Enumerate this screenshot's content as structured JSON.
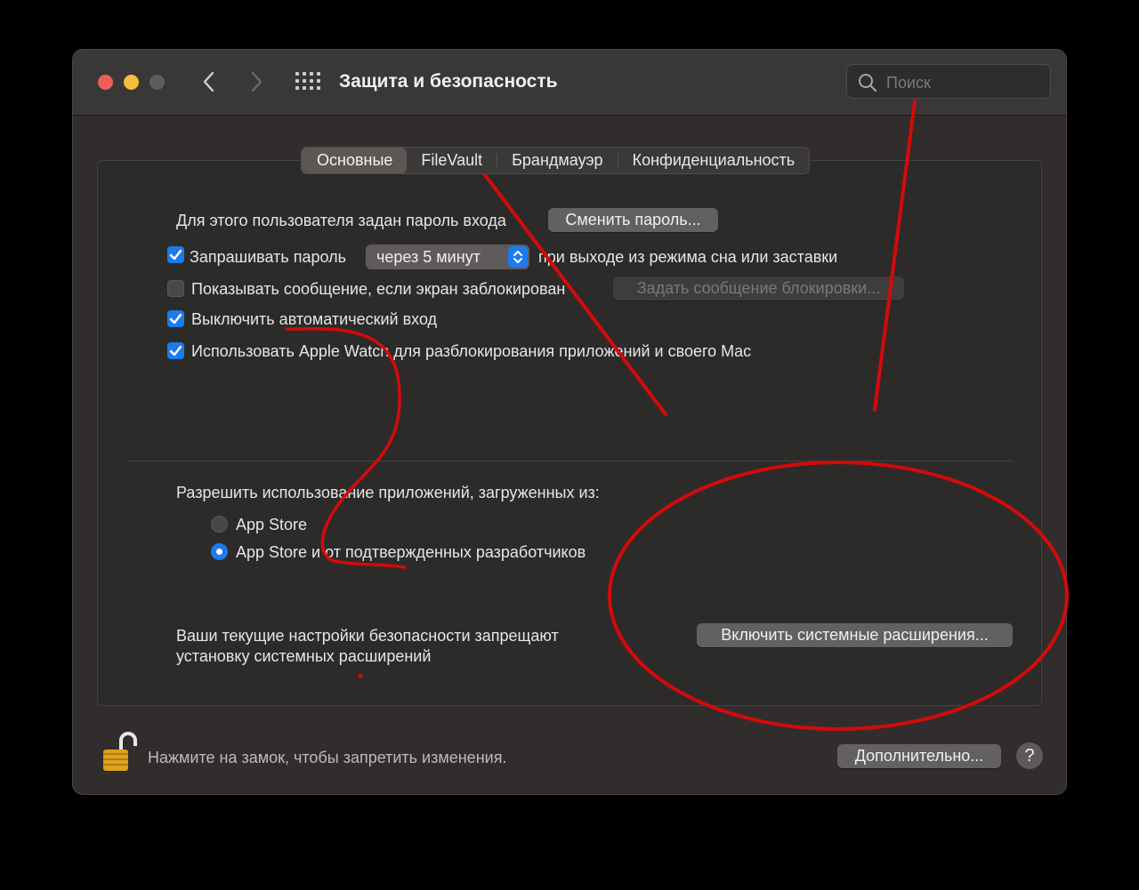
{
  "window": {
    "title": "Защита и безопасность",
    "search_placeholder": "Поиск"
  },
  "tabs": [
    {
      "label": "Основные",
      "selected": true
    },
    {
      "label": "FileVault",
      "selected": false
    },
    {
      "label": "Брандмауэр",
      "selected": false
    },
    {
      "label": "Конфиденциальность",
      "selected": false
    }
  ],
  "general": {
    "password_text": "Для этого пользователя задан пароль входа",
    "change_password_button": "Сменить пароль...",
    "require_password": {
      "checked": true,
      "label": "Запрашивать пароль",
      "select_value": "через 5 минут",
      "suffix": "при выходе из режима сна или заставки"
    },
    "show_message": {
      "checked": false,
      "label": "Показывать сообщение, если экран заблокирован",
      "button": "Задать сообщение блокировки..."
    },
    "disable_autologin": {
      "checked": true,
      "label": "Выключить автоматический вход"
    },
    "apple_watch": {
      "checked": true,
      "label": "Использовать Apple Watch для разблокирования приложений и своего Mac"
    }
  },
  "downloads": {
    "heading": "Разрешить использование приложений, загруженных из:",
    "options": [
      {
        "label": "App Store",
        "selected": false
      },
      {
        "label": "App Store и от подтвержденных разработчиков",
        "selected": true
      }
    ]
  },
  "extensions": {
    "line1": "Ваши текущие настройки безопасности запрещают",
    "line2": "установку системных расширений",
    "button": "Включить системные расширения..."
  },
  "footer": {
    "lock_text": "Нажмите на замок, чтобы запретить изменения.",
    "advanced_button": "Дополнительно...",
    "help_label": "?"
  },
  "colors": {
    "accent": "#1b7bf0",
    "annotation": "#d40a0a"
  }
}
